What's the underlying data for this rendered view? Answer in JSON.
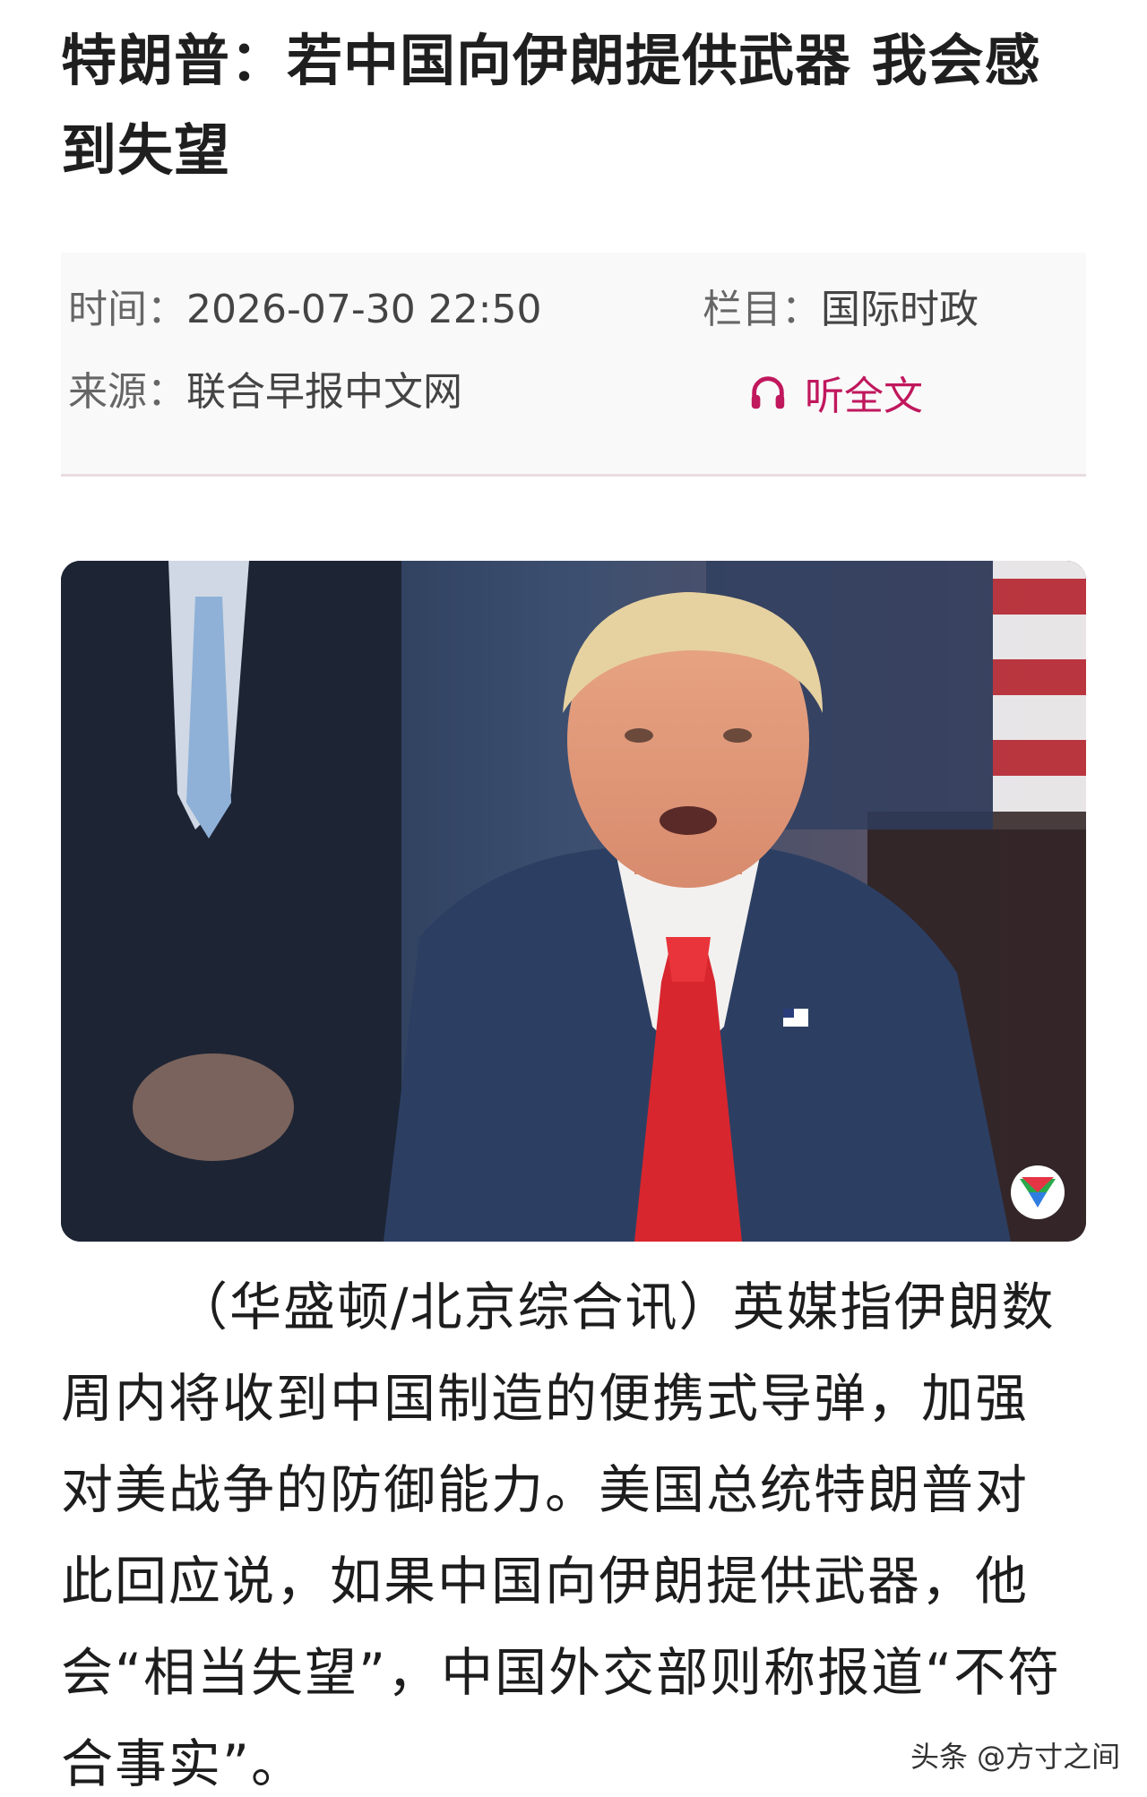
{
  "article": {
    "title": "特朗普：若中国向伊朗提供武器 我会感到失望",
    "meta": {
      "time_label": "时间：",
      "time_value": "2026-07-30 22:50",
      "column_label": "栏目：",
      "column_value": "国际时政",
      "source_label": "来源：",
      "source_value": "联合早报中文网",
      "listen_label": "听全文"
    },
    "body": "（华盛顿/北京综合讯）英媒指伊朗数周内将收到中国制造的便携式导弹，加强对美战争的防御能力。美国总统特朗普对此回应说，如果中国向伊朗提供武器，他会“相当失望”，中国外交部则称报道“不符合事实”。"
  },
  "watermark": "头条 @方寸之间",
  "colors": {
    "accent": "#c0175d",
    "tie": "#d8262e",
    "suit": "#2c3f63"
  },
  "icons": {
    "listen": "headphones-icon",
    "photo_badge": "play-logo-icon"
  }
}
